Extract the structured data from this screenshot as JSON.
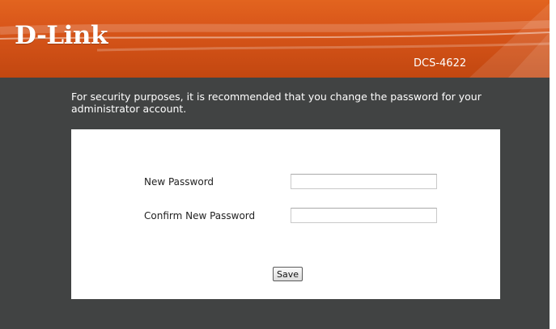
{
  "header": {
    "brand": "D-Link",
    "model": "DCS-4622",
    "colors": {
      "banner": "#d9561a",
      "body": "#414343"
    }
  },
  "intro_text": "For security purposes, it is recommended that you change the password for your administrator account.",
  "form": {
    "new_password_label": "New Password",
    "new_password_value": "",
    "confirm_password_label": "Confirm New Password",
    "confirm_password_value": "",
    "save_label": "Save"
  }
}
